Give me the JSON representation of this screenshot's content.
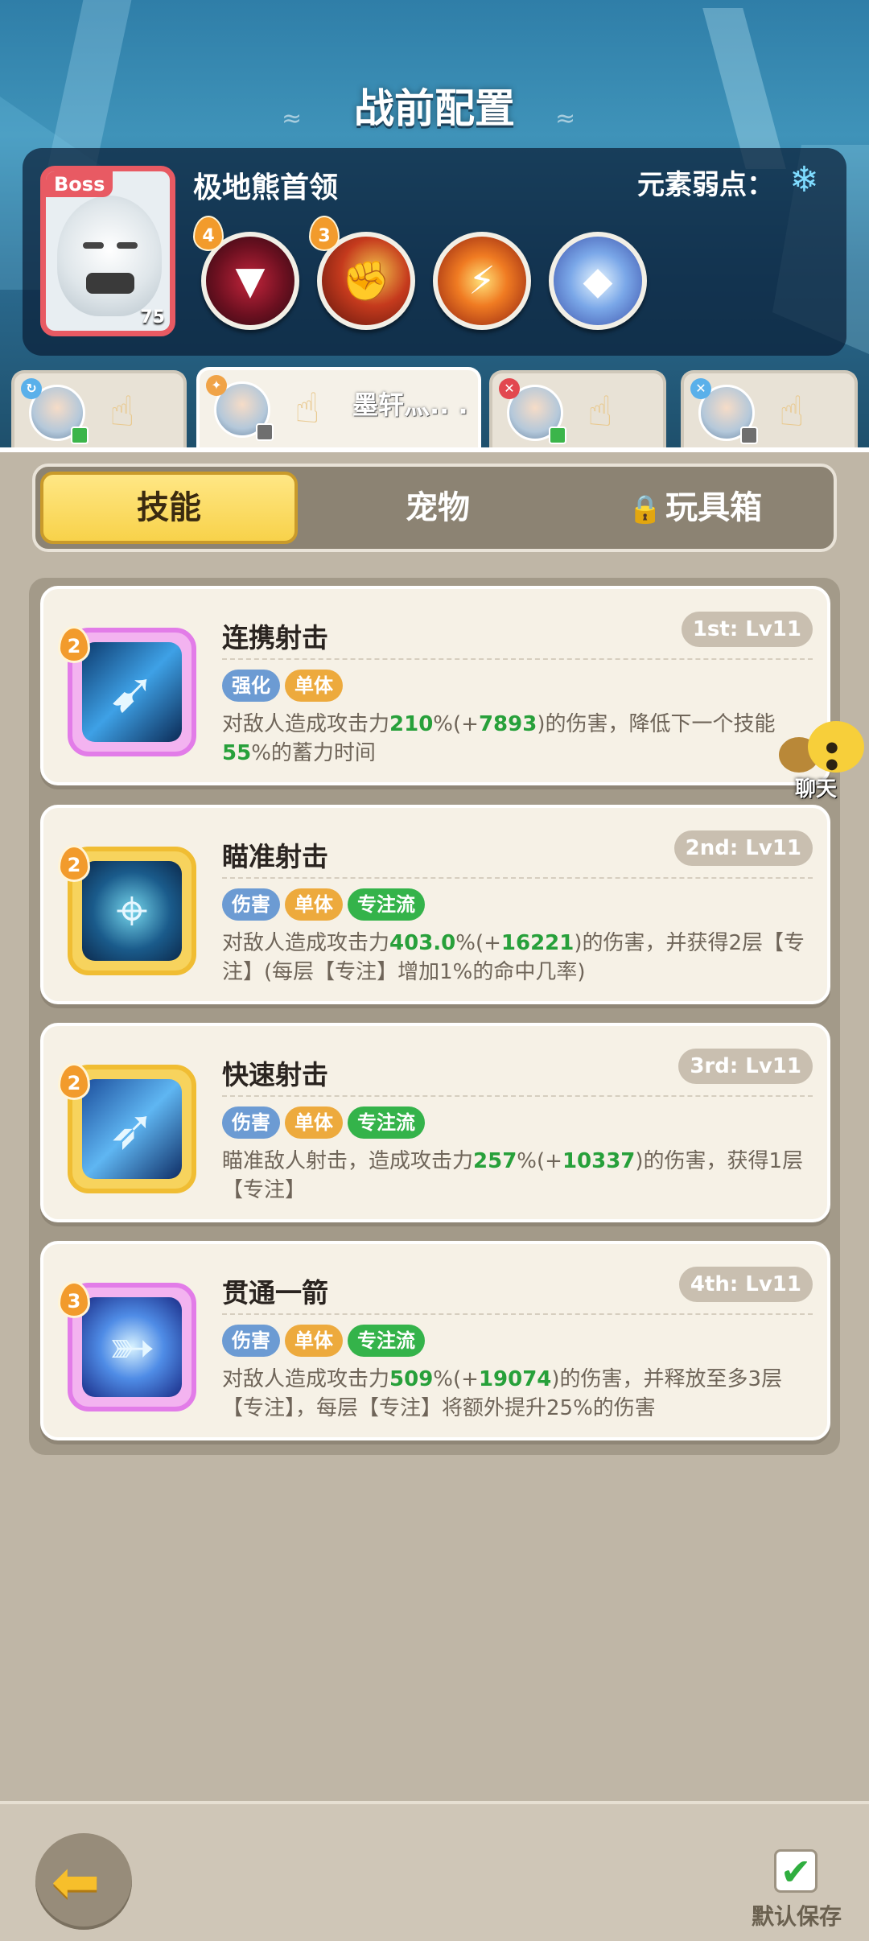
{
  "header": {
    "title": "战前配置"
  },
  "boss": {
    "tag": "Boss",
    "level": "75",
    "name": "极地熊首领",
    "weakness_label": "元素弱点：",
    "weakness_icon": "snowflake-icon",
    "skills": [
      {
        "icon": "bite-icon",
        "badge": "4"
      },
      {
        "icon": "fire-claw-icon",
        "badge": "3"
      },
      {
        "icon": "flame-slash-icon",
        "badge": ""
      },
      {
        "icon": "ice-crystal-icon",
        "badge": ""
      }
    ]
  },
  "hero_tabs": [
    {
      "name": "",
      "selected": false
    },
    {
      "name": "墨轩灬.. .",
      "selected": true
    },
    {
      "name": "",
      "selected": false
    },
    {
      "name": "",
      "selected": false
    }
  ],
  "segment_tabs": {
    "skills": "技能",
    "pets": "宠物",
    "toybox": "玩具箱",
    "active": "技能"
  },
  "skills": [
    {
      "name": "连携射击",
      "slot": "1st: Lv11",
      "cost": "2",
      "tags": [
        "强化",
        "单体"
      ],
      "desc_parts": [
        "对敌人造成攻击力",
        "210",
        "%(+",
        "7893",
        ")的伤害，降低下一个技能",
        "55",
        "%的蓄力时间"
      ]
    },
    {
      "name": "瞄准射击",
      "slot": "2nd: Lv11",
      "cost": "2",
      "tags": [
        "伤害",
        "单体",
        "专注流"
      ],
      "desc_parts": [
        "对敌人造成攻击力",
        "403.0",
        "%(+",
        "16221",
        ")的伤害，并获得2层【专注】(每层【专注】增加1%的命中几率)"
      ]
    },
    {
      "name": "快速射击",
      "slot": "3rd: Lv11",
      "cost": "2",
      "tags": [
        "伤害",
        "单体",
        "专注流"
      ],
      "desc_parts": [
        "瞄准敌人射击，造成攻击力",
        "257",
        "%(+",
        "10337",
        ")的伤害，获得1层【专注】"
      ]
    },
    {
      "name": "贯通一箭",
      "slot": "4th: Lv11",
      "cost": "3",
      "tags": [
        "伤害",
        "单体",
        "专注流"
      ],
      "desc_parts": [
        "对敌人造成攻击力",
        "509",
        "%(+",
        "19074",
        ")的伤害，并释放至多3层【专注】，每层【专注】将额外提升25%的伤害"
      ]
    }
  ],
  "chat": {
    "label": "聊天"
  },
  "footer": {
    "save_label": "默认保存",
    "save_checked": true
  }
}
